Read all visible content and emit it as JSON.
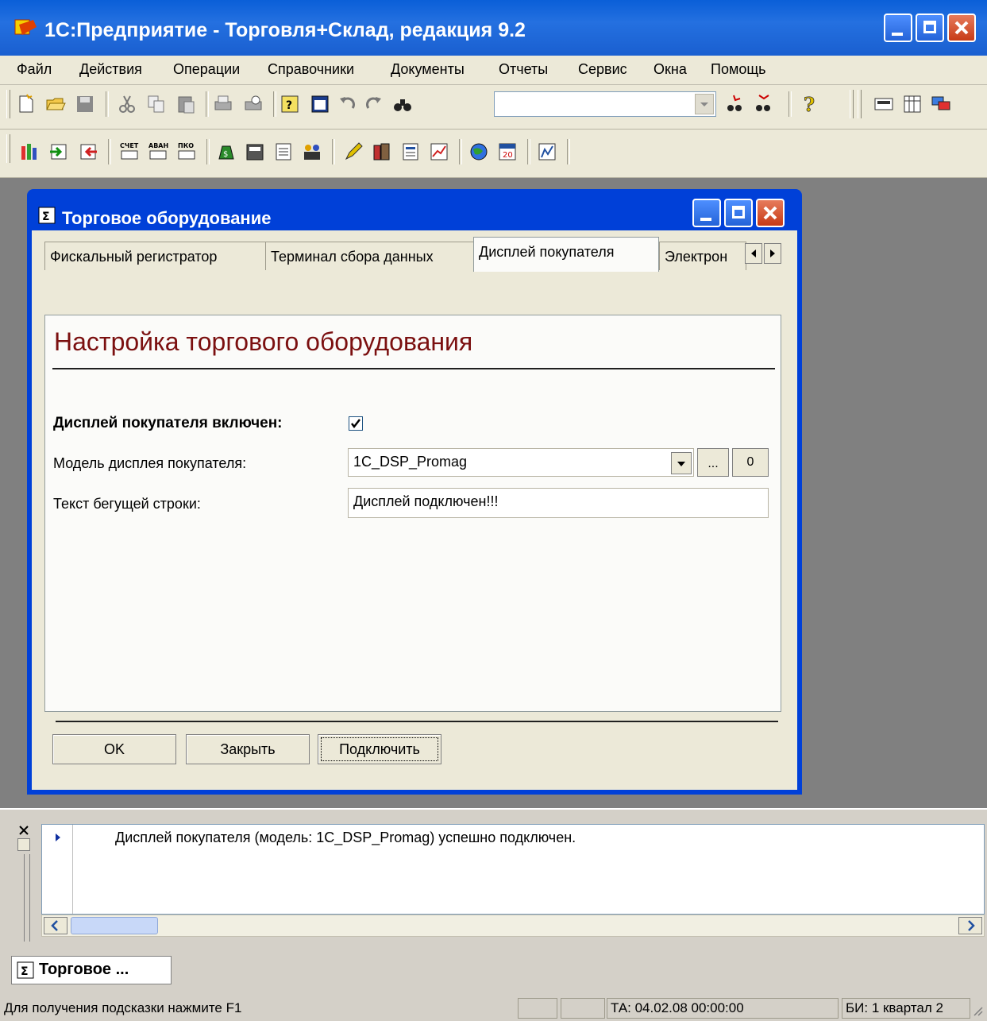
{
  "window": {
    "title": "1С:Предприятие - Торговля+Склад, редакция 9.2"
  },
  "menu": [
    "Файл",
    "Действия",
    "Операции",
    "Справочники",
    "Документы",
    "Отчеты",
    "Сервис",
    "Окна",
    "Помощь"
  ],
  "toolbar": {
    "search_value": ""
  },
  "dialog": {
    "title": "Торговое оборудование",
    "tabs": [
      "Фискальный регистратор",
      "Терминал сбора данных",
      "Дисплей покупателя",
      "Электрон"
    ],
    "active_tab": "Дисплей покупателя",
    "heading": "Настройка торгового оборудования",
    "enabled_label": "Дисплей покупателя включен:",
    "enabled_checked": true,
    "model_label": "Модель дисплея покупателя:",
    "model_value": "1C_DSP_Promag",
    "ellipsis_btn": "...",
    "clear_btn": "0",
    "marquee_label": "Текст бегущей строки:",
    "marquee_value": "Дисплей подключен!!!",
    "ok_btn": "OK",
    "close_btn": "Закрыть",
    "connect_btn": "Подключить"
  },
  "messages": {
    "line1": "Дисплей покупателя (модель: 1C_DSP_Promag) успешно подключен."
  },
  "taskbar": {
    "item": "Торговое ..."
  },
  "statusbar": {
    "hint": "Для получения подсказки нажмите F1",
    "ta": "ТА: 04.02.08  00:00:00",
    "bi": "БИ: 1 квартал 2"
  },
  "colors": {
    "titlebar": "#0a5fd8",
    "heading": "#7b1010"
  }
}
